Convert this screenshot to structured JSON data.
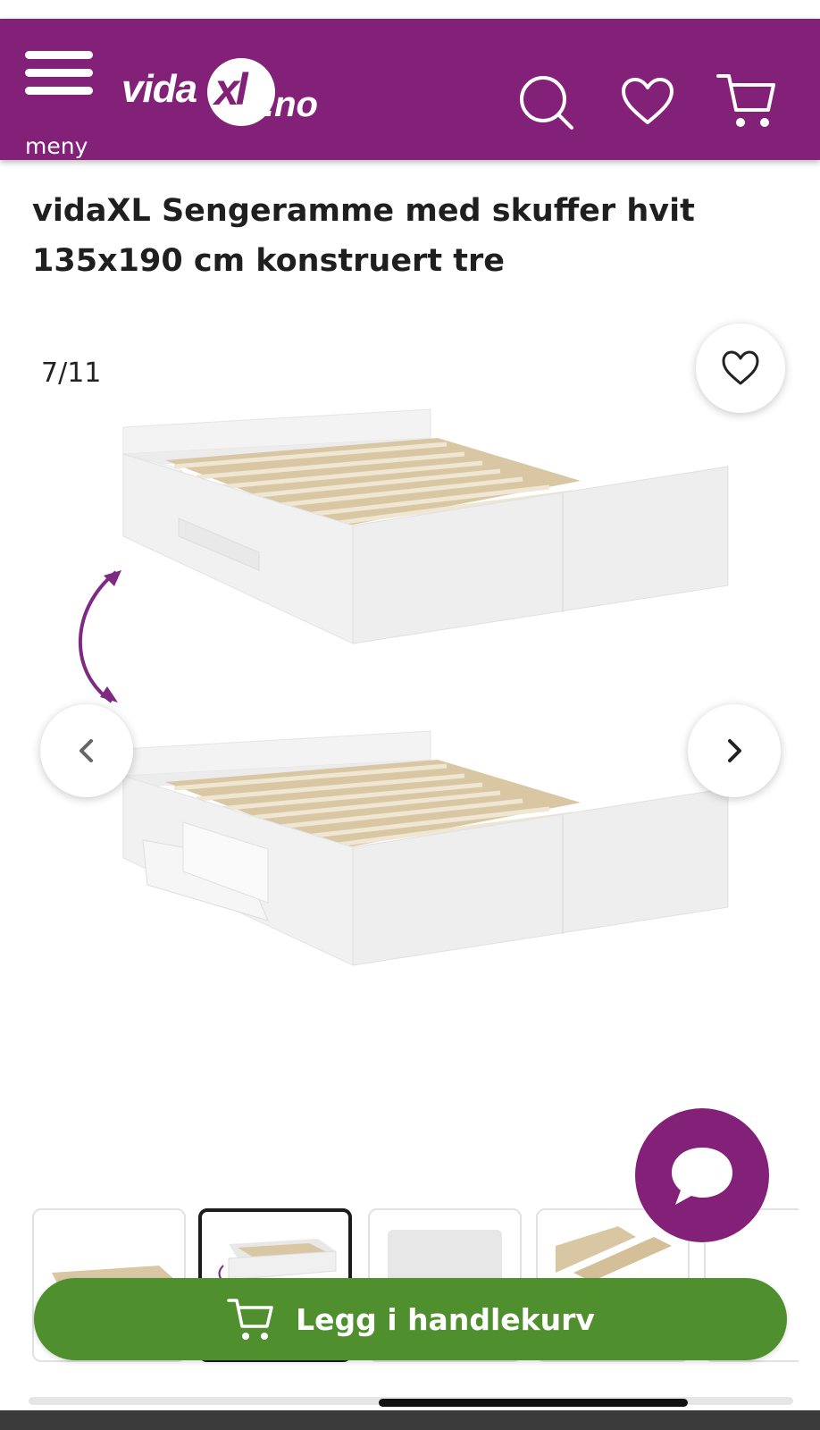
{
  "header": {
    "menu_label": "meny",
    "logo": {
      "text": "vida",
      "xl": "xl",
      "tld": ".no"
    },
    "icons": [
      "search-icon",
      "heart-icon",
      "cart-icon"
    ],
    "brand_color": "#832078"
  },
  "product": {
    "title": "vidaXL Sengeramme med skuffer hvit 135x190 cm konstruert tre",
    "gallery": {
      "counter": "7/11",
      "current": 7,
      "total": 11
    }
  },
  "cta": {
    "add_to_cart_label": "Legg i handlekurv",
    "color": "#4f8f2d"
  },
  "chat": {
    "icon": "chat-bubble-icon"
  }
}
